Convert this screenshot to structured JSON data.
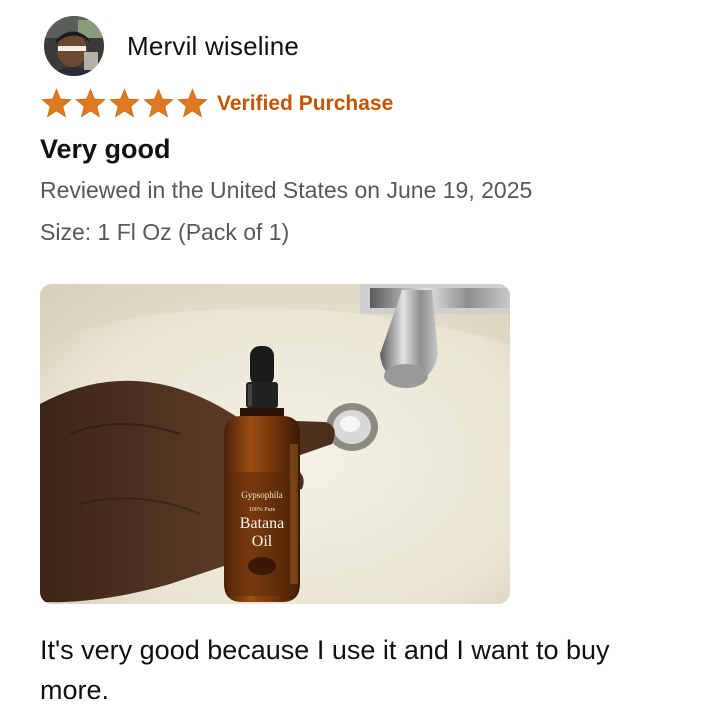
{
  "reviewer": {
    "name": "Mervil wiseline",
    "avatar_icon": "user-avatar-photo"
  },
  "rating": {
    "stars": 5,
    "max_stars": 5,
    "star_color": "#de7921"
  },
  "badge": {
    "label": "Verified Purchase",
    "color": "#c45500"
  },
  "review": {
    "title": "Very good",
    "date_line": "Reviewed in the United States on June 19, 2025",
    "variant_line": "Size: 1 Fl Oz (Pack of 1)",
    "body": "It's very good because I use it and I want to buy more."
  },
  "photo": {
    "label_brand": "Gypsophila",
    "label_sub": "100% Pure",
    "label_line1": "Batana",
    "label_line2": "Oil"
  }
}
